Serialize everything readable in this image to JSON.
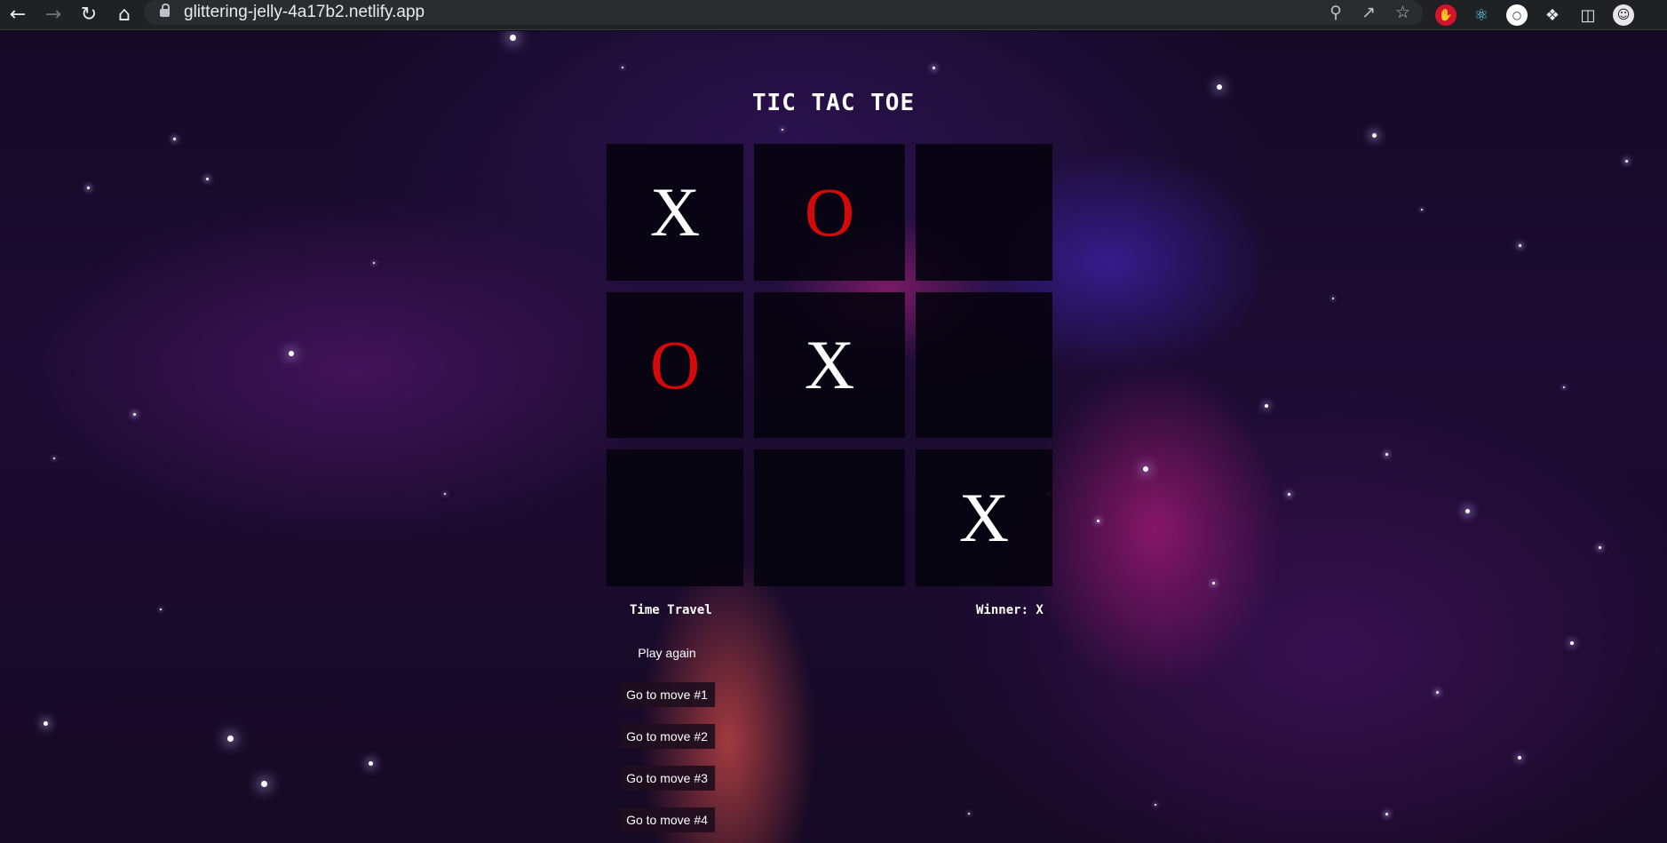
{
  "browser": {
    "url": "glittering-jelly-4a17b2.netlify.app",
    "nav_icons": [
      "back-icon",
      "forward-icon",
      "reload-icon",
      "home-icon"
    ],
    "omnibox_icons": [
      "zoom-icon",
      "share-icon",
      "bookmark-star-icon"
    ],
    "extension_icons": [
      "adblock-icon",
      "react-devtools-icon",
      "circle-extension-icon",
      "extensions-puzzle-icon",
      "side-panel-icon",
      "profile-avatar-icon"
    ]
  },
  "game": {
    "title": "TIC TAC TOE",
    "squares": [
      "X",
      "O",
      "",
      "O",
      "X",
      "",
      "",
      "",
      "X"
    ],
    "time_travel_label": "Time Travel",
    "status": "Winner: X",
    "moves": [
      "Play again",
      "Go to move #1",
      "Go to move #2",
      "Go to move #3",
      "Go to move #4"
    ]
  },
  "colors": {
    "x_mark": "#ffffff",
    "o_mark": "#d40a0a",
    "square_bg": "#06030e"
  }
}
